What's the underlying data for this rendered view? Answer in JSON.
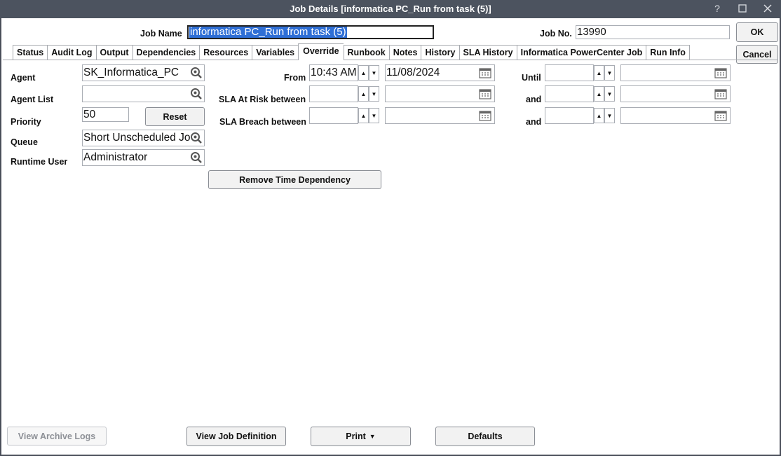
{
  "window": {
    "title": "Job Details [informatica PC_Run from task (5)]",
    "controls": {
      "help": "?",
      "maximize": "☐",
      "close": "✕"
    }
  },
  "header": {
    "job_name_label": "Job Name",
    "job_name_value": "informatica PC_Run from task (5)",
    "job_no_label": "Job No.",
    "job_no_value": "13990"
  },
  "actions": {
    "ok": "OK",
    "cancel": "Cancel"
  },
  "tabs": [
    {
      "label": "Status"
    },
    {
      "label": "Audit Log"
    },
    {
      "label": "Output"
    },
    {
      "label": "Dependencies"
    },
    {
      "label": "Resources"
    },
    {
      "label": "Variables"
    },
    {
      "label": "Override"
    },
    {
      "label": "Runbook"
    },
    {
      "label": "Notes"
    },
    {
      "label": "History"
    },
    {
      "label": "SLA History"
    },
    {
      "label": "Informatica PowerCenter Job"
    },
    {
      "label": "Run Info"
    }
  ],
  "active_tab": "Override",
  "override": {
    "agent_label": "Agent",
    "agent_value": "SK_Informatica_PC",
    "agent_list_label": "Agent List",
    "agent_list_value": "",
    "priority_label": "Priority",
    "priority_value": "50",
    "reset_label": "Reset",
    "queue_label": "Queue",
    "queue_value": "Short Unscheduled Jobs",
    "runtime_user_label": "Runtime User",
    "runtime_user_value": "Administrator",
    "from_label": "From",
    "from_time": "10:43 AM",
    "from_date": "11/08/2024",
    "until_label": "Until",
    "until_time": "",
    "until_date": "",
    "sla_risk_label": "SLA At Risk between",
    "sla_risk_time": "",
    "sla_risk_date": "",
    "sla_risk_and_label": "and",
    "sla_risk_and_time": "",
    "sla_risk_and_date": "",
    "sla_breach_label": "SLA Breach between",
    "sla_breach_time": "",
    "sla_breach_date": "",
    "sla_breach_and_label": "and",
    "sla_breach_and_time": "",
    "sla_breach_and_date": "",
    "remove_time_dep_label": "Remove Time Dependency"
  },
  "footer": {
    "view_archive_logs": "View Archive Logs",
    "view_job_definition": "View Job Definition",
    "print": "Print",
    "defaults": "Defaults"
  },
  "colors": {
    "titlebar": "#4c535f",
    "selection": "#2f6fd6"
  }
}
